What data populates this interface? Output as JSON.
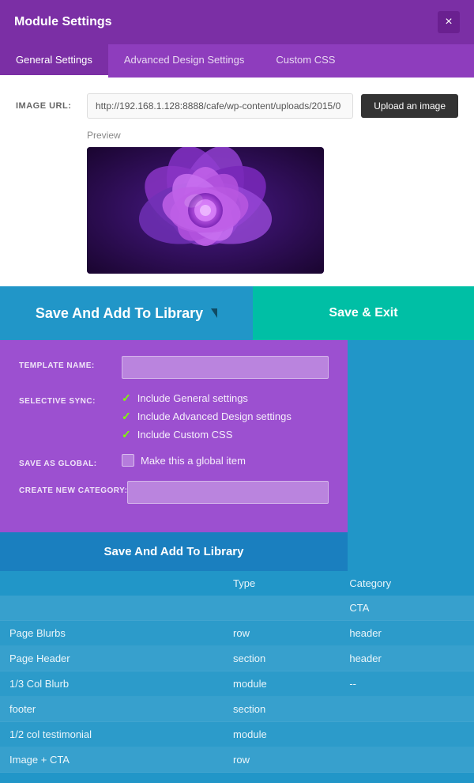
{
  "header": {
    "title": "Module Settings",
    "close_label": "×"
  },
  "tabs": [
    {
      "label": "General Settings",
      "active": true
    },
    {
      "label": "Advanced Design Settings",
      "active": false
    },
    {
      "label": "Custom CSS",
      "active": false
    }
  ],
  "image_field": {
    "label": "IMAGE URL:",
    "value": "http://192.168.1.128:8888/cafe/wp-content/uploads/2015/0",
    "upload_btn": "Upload an image",
    "preview_label": "Preview"
  },
  "actions": {
    "save_library": "Save And Add To Library",
    "save_exit": "Save & Exit"
  },
  "library_form": {
    "template_name_label": "TEMPLATE NAME:",
    "template_name_placeholder": "",
    "selective_sync_label": "SELECTIVE SYNC:",
    "sync_options": [
      "Include General settings",
      "Include Advanced Design settings",
      "Include Custom CSS"
    ],
    "save_global_label": "SAVE AS GLOBAL:",
    "save_global_text": "Make this a global item",
    "new_category_label": "CREATE NEW CATEGORY:",
    "save_btn": "Save And Add To Library"
  },
  "table": {
    "headers": [
      "",
      "Type",
      "Category"
    ],
    "rows": [
      {
        "name": "",
        "type": "",
        "category": "CTA"
      },
      {
        "name": "Page Blurbs",
        "type": "row",
        "category": "header"
      },
      {
        "name": "Page Header",
        "type": "section",
        "category": "header"
      },
      {
        "name": "1/3 Col Blurb",
        "type": "module",
        "category": "--"
      },
      {
        "name": "footer",
        "type": "section",
        "category": ""
      },
      {
        "name": "1/2 col testimonial",
        "type": "module",
        "category": ""
      },
      {
        "name": "Image + CTA",
        "type": "row",
        "category": ""
      }
    ]
  }
}
